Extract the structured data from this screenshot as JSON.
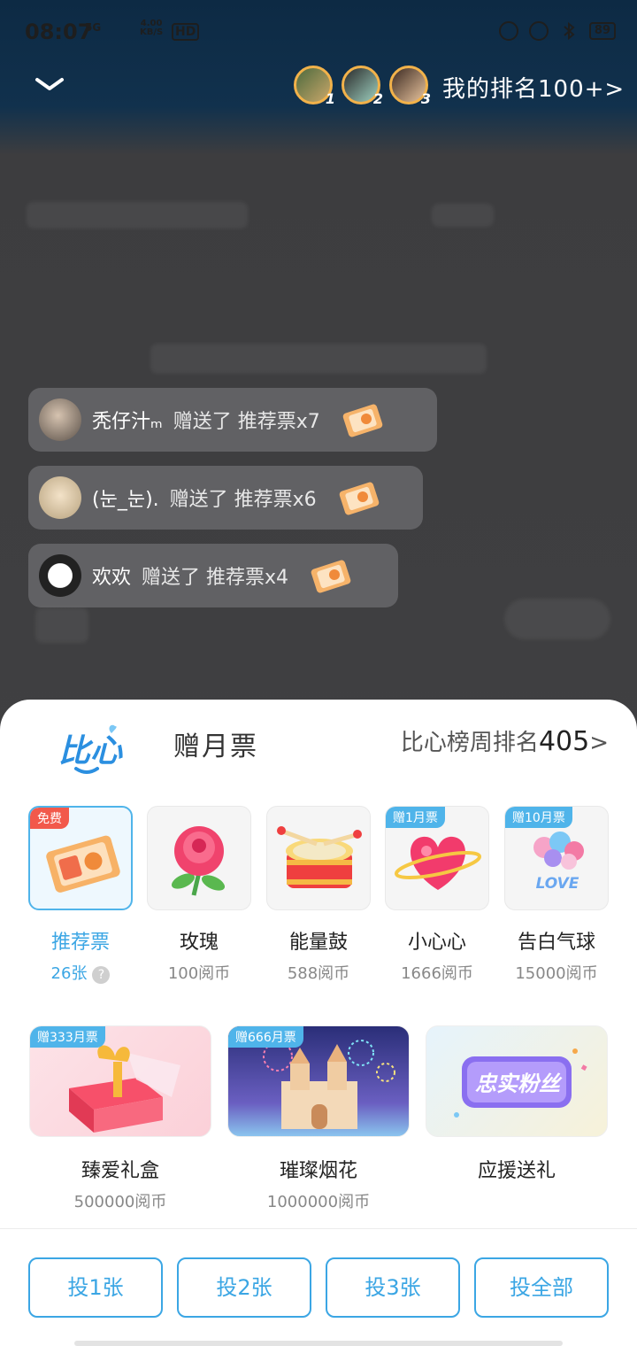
{
  "status_bar": {
    "time": "08:07",
    "network": "5G",
    "speed_value": "4.00",
    "speed_unit": "KB/S",
    "hd": "HD",
    "battery": "89"
  },
  "header": {
    "my_rank": "我的排名100+>"
  },
  "top_fans": [
    {
      "rank": "1"
    },
    {
      "rank": "2"
    },
    {
      "rank": "3"
    }
  ],
  "notifications": [
    {
      "user": "秃仔汁ₘ",
      "action": "赠送了 推荐票x7"
    },
    {
      "user": "(눈_눈).",
      "action": "赠送了 推荐票x6"
    },
    {
      "user": "欢欢",
      "action": "赠送了 推荐票x4"
    }
  ],
  "sheet": {
    "logo_text": "比心",
    "tab_label": "赠月票",
    "week_rank_label": "比心榜周排名",
    "week_rank_value": "405",
    "week_rank_arrow": ">"
  },
  "gifts": [
    {
      "name": "推荐票",
      "price": "26张",
      "tag": "免费",
      "icon": "ticket-icon",
      "selected": true
    },
    {
      "name": "玫瑰",
      "price": "100阅币",
      "tag": "",
      "icon": "rose-icon"
    },
    {
      "name": "能量鼓",
      "price": "588阅币",
      "tag": "",
      "icon": "drum-icon"
    },
    {
      "name": "小心心",
      "price": "1666阅币",
      "tag": "赠1月票",
      "icon": "heart-icon"
    },
    {
      "name": "告白气球",
      "price": "15000阅币",
      "tag": "赠10月票",
      "icon": "balloon-icon"
    }
  ],
  "big_gifts": [
    {
      "name": "臻爱礼盒",
      "price": "500000阅币",
      "tag": "赠333月票",
      "icon": "gift-box-icon"
    },
    {
      "name": "璀璨烟花",
      "price": "1000000阅币",
      "tag": "赠666月票",
      "icon": "fireworks-castle-icon"
    },
    {
      "name": "应援送礼",
      "price": "",
      "tag": "",
      "banner": "忠实粉丝",
      "icon": "fan-badge-icon"
    }
  ],
  "vote_buttons": [
    "投1张",
    "投2张",
    "投3张",
    "投全部"
  ],
  "colors": {
    "accent": "#3ba6e4",
    "free_tag": "#f2594b",
    "month_tag": "#4fb4ea"
  }
}
